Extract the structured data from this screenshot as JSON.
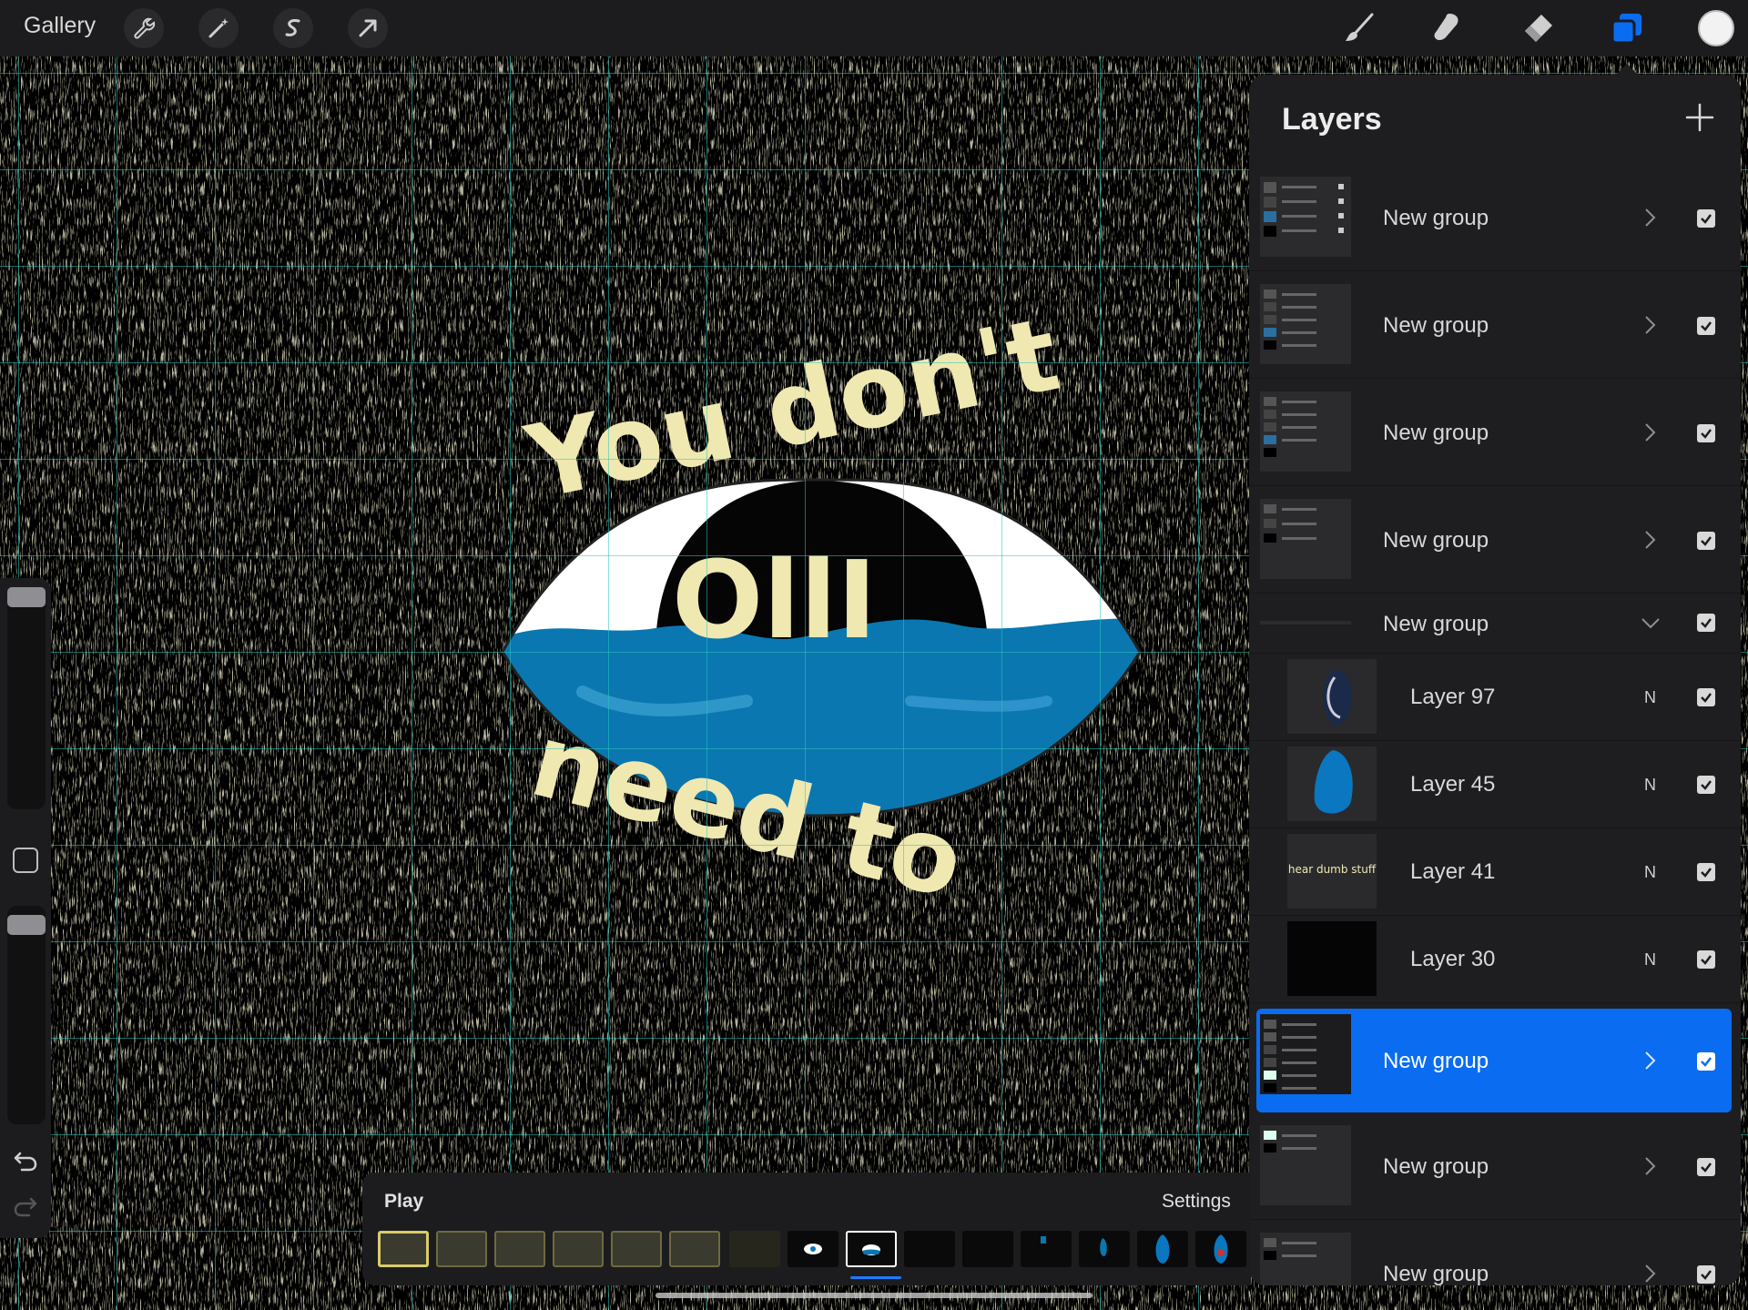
{
  "topbar": {
    "gallery_label": "Gallery",
    "left_tools": [
      "wrench-icon",
      "magic-wand-icon",
      "selection-icon",
      "transform-arrow-icon"
    ],
    "right_tools": [
      "brush-icon",
      "smudge-icon",
      "eraser-icon",
      "layers-icon",
      "color-icon"
    ],
    "active_tool": "layers-icon",
    "accent_color": "#0a6cf0",
    "current_color": "#f2f2f2"
  },
  "canvas": {
    "line1": "You don't",
    "line2": "need to",
    "iris_text": "OllI",
    "eye_fill": "#0a77b0",
    "text_color": "#efe8b0",
    "background": "#000000"
  },
  "sidebar": {
    "controls": [
      "brush-size-slider",
      "modifier-button",
      "opacity-slider",
      "undo-icon",
      "redo-icon"
    ]
  },
  "layers_panel": {
    "title": "Layers",
    "add_icon": "plus-icon",
    "rows": [
      {
        "name": "New group",
        "kind": "group",
        "chevron": "right",
        "visible": true,
        "selected": false
      },
      {
        "name": "New group",
        "kind": "group",
        "chevron": "right",
        "visible": true,
        "selected": false
      },
      {
        "name": "New group",
        "kind": "group",
        "chevron": "right",
        "visible": true,
        "selected": false
      },
      {
        "name": "New group",
        "kind": "group",
        "chevron": "right",
        "visible": true,
        "selected": false
      },
      {
        "name": "New group",
        "kind": "group-open",
        "chevron": "down",
        "visible": true,
        "selected": false
      },
      {
        "name": "Layer 97",
        "kind": "layer",
        "blend": "N",
        "visible": true,
        "selected": false
      },
      {
        "name": "Layer 45",
        "kind": "layer",
        "blend": "N",
        "visible": true,
        "selected": false
      },
      {
        "name": "Layer 41",
        "kind": "layer",
        "blend": "N",
        "visible": true,
        "selected": false,
        "thumb_text": "hear dumb stuff"
      },
      {
        "name": "Layer 30",
        "kind": "layer",
        "blend": "N",
        "visible": true,
        "selected": false
      },
      {
        "name": "New group",
        "kind": "group",
        "chevron": "right",
        "visible": true,
        "selected": true
      },
      {
        "name": "New group",
        "kind": "group",
        "chevron": "right",
        "visible": true,
        "selected": false
      },
      {
        "name": "New group",
        "kind": "group",
        "chevron": "right",
        "visible": true,
        "selected": false
      }
    ]
  },
  "timeline": {
    "play_label": "Play",
    "settings_label": "Settings",
    "frame_count": 15,
    "current_frame": 9
  }
}
